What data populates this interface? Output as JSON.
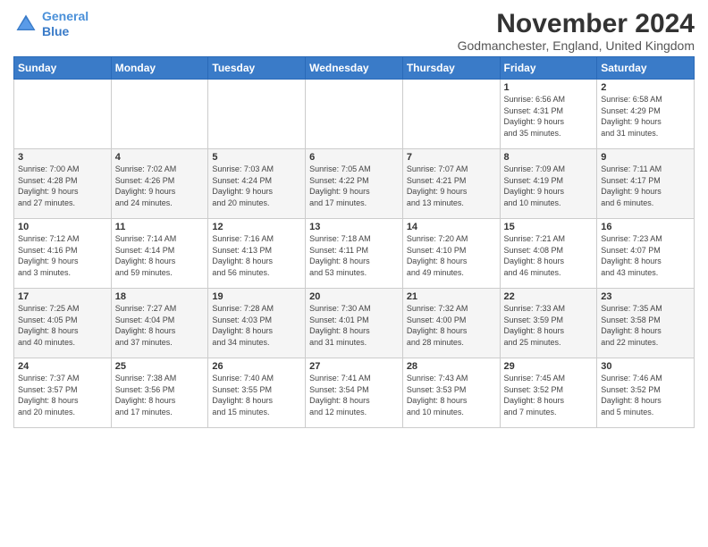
{
  "header": {
    "logo_line1": "General",
    "logo_line2": "Blue",
    "month_title": "November 2024",
    "subtitle": "Godmanchester, England, United Kingdom"
  },
  "weekdays": [
    "Sunday",
    "Monday",
    "Tuesday",
    "Wednesday",
    "Thursday",
    "Friday",
    "Saturday"
  ],
  "weeks": [
    [
      {
        "day": "",
        "info": ""
      },
      {
        "day": "",
        "info": ""
      },
      {
        "day": "",
        "info": ""
      },
      {
        "day": "",
        "info": ""
      },
      {
        "day": "",
        "info": ""
      },
      {
        "day": "1",
        "info": "Sunrise: 6:56 AM\nSunset: 4:31 PM\nDaylight: 9 hours\nand 35 minutes."
      },
      {
        "day": "2",
        "info": "Sunrise: 6:58 AM\nSunset: 4:29 PM\nDaylight: 9 hours\nand 31 minutes."
      }
    ],
    [
      {
        "day": "3",
        "info": "Sunrise: 7:00 AM\nSunset: 4:28 PM\nDaylight: 9 hours\nand 27 minutes."
      },
      {
        "day": "4",
        "info": "Sunrise: 7:02 AM\nSunset: 4:26 PM\nDaylight: 9 hours\nand 24 minutes."
      },
      {
        "day": "5",
        "info": "Sunrise: 7:03 AM\nSunset: 4:24 PM\nDaylight: 9 hours\nand 20 minutes."
      },
      {
        "day": "6",
        "info": "Sunrise: 7:05 AM\nSunset: 4:22 PM\nDaylight: 9 hours\nand 17 minutes."
      },
      {
        "day": "7",
        "info": "Sunrise: 7:07 AM\nSunset: 4:21 PM\nDaylight: 9 hours\nand 13 minutes."
      },
      {
        "day": "8",
        "info": "Sunrise: 7:09 AM\nSunset: 4:19 PM\nDaylight: 9 hours\nand 10 minutes."
      },
      {
        "day": "9",
        "info": "Sunrise: 7:11 AM\nSunset: 4:17 PM\nDaylight: 9 hours\nand 6 minutes."
      }
    ],
    [
      {
        "day": "10",
        "info": "Sunrise: 7:12 AM\nSunset: 4:16 PM\nDaylight: 9 hours\nand 3 minutes."
      },
      {
        "day": "11",
        "info": "Sunrise: 7:14 AM\nSunset: 4:14 PM\nDaylight: 8 hours\nand 59 minutes."
      },
      {
        "day": "12",
        "info": "Sunrise: 7:16 AM\nSunset: 4:13 PM\nDaylight: 8 hours\nand 56 minutes."
      },
      {
        "day": "13",
        "info": "Sunrise: 7:18 AM\nSunset: 4:11 PM\nDaylight: 8 hours\nand 53 minutes."
      },
      {
        "day": "14",
        "info": "Sunrise: 7:20 AM\nSunset: 4:10 PM\nDaylight: 8 hours\nand 49 minutes."
      },
      {
        "day": "15",
        "info": "Sunrise: 7:21 AM\nSunset: 4:08 PM\nDaylight: 8 hours\nand 46 minutes."
      },
      {
        "day": "16",
        "info": "Sunrise: 7:23 AM\nSunset: 4:07 PM\nDaylight: 8 hours\nand 43 minutes."
      }
    ],
    [
      {
        "day": "17",
        "info": "Sunrise: 7:25 AM\nSunset: 4:05 PM\nDaylight: 8 hours\nand 40 minutes."
      },
      {
        "day": "18",
        "info": "Sunrise: 7:27 AM\nSunset: 4:04 PM\nDaylight: 8 hours\nand 37 minutes."
      },
      {
        "day": "19",
        "info": "Sunrise: 7:28 AM\nSunset: 4:03 PM\nDaylight: 8 hours\nand 34 minutes."
      },
      {
        "day": "20",
        "info": "Sunrise: 7:30 AM\nSunset: 4:01 PM\nDaylight: 8 hours\nand 31 minutes."
      },
      {
        "day": "21",
        "info": "Sunrise: 7:32 AM\nSunset: 4:00 PM\nDaylight: 8 hours\nand 28 minutes."
      },
      {
        "day": "22",
        "info": "Sunrise: 7:33 AM\nSunset: 3:59 PM\nDaylight: 8 hours\nand 25 minutes."
      },
      {
        "day": "23",
        "info": "Sunrise: 7:35 AM\nSunset: 3:58 PM\nDaylight: 8 hours\nand 22 minutes."
      }
    ],
    [
      {
        "day": "24",
        "info": "Sunrise: 7:37 AM\nSunset: 3:57 PM\nDaylight: 8 hours\nand 20 minutes."
      },
      {
        "day": "25",
        "info": "Sunrise: 7:38 AM\nSunset: 3:56 PM\nDaylight: 8 hours\nand 17 minutes."
      },
      {
        "day": "26",
        "info": "Sunrise: 7:40 AM\nSunset: 3:55 PM\nDaylight: 8 hours\nand 15 minutes."
      },
      {
        "day": "27",
        "info": "Sunrise: 7:41 AM\nSunset: 3:54 PM\nDaylight: 8 hours\nand 12 minutes."
      },
      {
        "day": "28",
        "info": "Sunrise: 7:43 AM\nSunset: 3:53 PM\nDaylight: 8 hours\nand 10 minutes."
      },
      {
        "day": "29",
        "info": "Sunrise: 7:45 AM\nSunset: 3:52 PM\nDaylight: 8 hours\nand 7 minutes."
      },
      {
        "day": "30",
        "info": "Sunrise: 7:46 AM\nSunset: 3:52 PM\nDaylight: 8 hours\nand 5 minutes."
      }
    ]
  ]
}
